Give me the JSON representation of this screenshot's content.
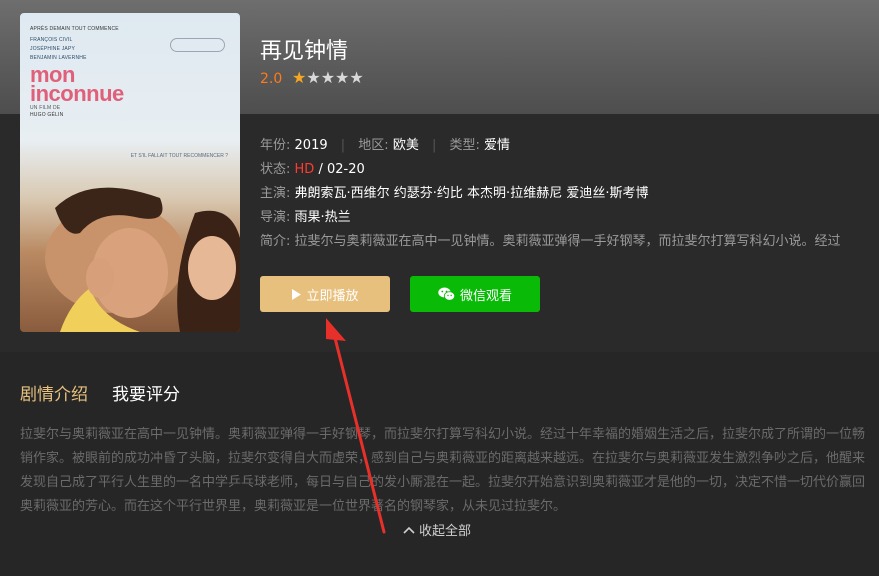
{
  "poster": {
    "line1": "APRÈS DEMAIN TOUT COMMENCE",
    "cast": [
      "FRANÇOIS CIVIL",
      "JOSÉPHINE JAPY",
      "BENJAMIN LAVERNHE"
    ],
    "title_line1": "mon",
    "title_line2": "inconnue",
    "film_by": "UN FILM DE",
    "director": "HUGO GÉLIN",
    "tagline": "ET S'IL FALLAIT TOUT RECOMMENCER ?"
  },
  "movie": {
    "title": "再见钟情",
    "rating": "2.0",
    "stars": {
      "filled": 1,
      "total": 5
    },
    "year_label": "年份:",
    "year": "2019",
    "region_label": "地区:",
    "region": "欧美",
    "genre_label": "类型:",
    "genre": "爱情",
    "status_label": "状态:",
    "status_quality": "HD",
    "status_date": " / 02-20",
    "cast_label": "主演:",
    "cast": "弗朗索瓦·西维尔 约瑟芬·约比 本杰明·拉维赫尼 爱迪丝·斯考博",
    "director_label": "导演:",
    "director": "雨果·热兰",
    "intro_label": "简介:",
    "intro": "拉斐尔与奥莉薇亚在高中一见钟情。奥莉薇亚弹得一手好钢琴，而拉斐尔打算写科幻小说。经过"
  },
  "buttons": {
    "play": "立即播放",
    "wechat": "微信观看"
  },
  "tabs": {
    "active": "剧情介绍",
    "other": "我要评分"
  },
  "description": "拉斐尔与奥莉薇亚在高中一见钟情。奥莉薇亚弹得一手好钢琴，而拉斐尔打算写科幻小说。经过十年幸福的婚姻生活之后，拉斐尔成了所谓的一位畅销作家。被眼前的成功冲昏了头脑，拉斐尔变得自大而虚荣，感到自己与奥莉薇亚的距离越来越远。在拉斐尔与奥莉薇亚发生激烈争吵之后，他醒来发现自己成了平行人生里的一名中学乒乓球老师，每日与自己的发小厮混在一起。拉斐尔开始意识到奥莉薇亚才是他的一切，决定不惜一切代价赢回奥莉薇亚的芳心。而在这个平行世界里，奥莉薇亚是一位世界著名的钢琴家，从未见过拉斐尔。",
  "collapse": "收起全部",
  "colors": {
    "accent": "#e7c07e",
    "wechat_green": "#09bb07",
    "hd_red": "#ff3b30",
    "arrow_red": "#e8302a"
  }
}
